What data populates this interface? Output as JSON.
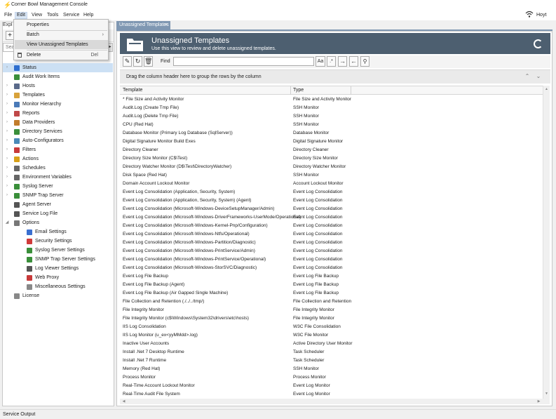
{
  "window": {
    "title": "Corner Bowl Management Console",
    "user": "Hoyt"
  },
  "menu": {
    "file": "File",
    "edit": "Edit",
    "view": "View",
    "tools": "Tools",
    "service": "Service",
    "help": "Help"
  },
  "edit_menu": {
    "properties": "Properties",
    "batch": "Batch",
    "view_unassigned": "View Unassigned Templates",
    "delete": "Delete",
    "delete_shortcut": "Del"
  },
  "explorer": {
    "tab_label": "Expl",
    "search_placeholder": "Sear"
  },
  "tree": [
    {
      "label": "Status",
      "icon": "info-icon",
      "color": "#2f6fcf"
    },
    {
      "label": "Audit Work Items",
      "icon": "checklist-icon",
      "color": "#3a8f3a"
    },
    {
      "label": "Hosts",
      "icon": "host-icon",
      "color": "#5a6a8a"
    },
    {
      "label": "Templates",
      "icon": "templates-icon",
      "color": "#d8a23a"
    },
    {
      "label": "Monitor Hierarchy",
      "icon": "hierarchy-icon",
      "color": "#4a7ab8"
    },
    {
      "label": "Reports",
      "icon": "report-icon",
      "color": "#c04848"
    },
    {
      "label": "Data Providers",
      "icon": "data-icon",
      "color": "#c27c2c"
    },
    {
      "label": "Directory Services",
      "icon": "tree-icon",
      "color": "#3b8f3b"
    },
    {
      "label": "Auto-Configurators",
      "icon": "gear-icon",
      "color": "#4a8ab8"
    },
    {
      "label": "Filters",
      "icon": "filter-icon",
      "color": "#c83a3a"
    },
    {
      "label": "Actions",
      "icon": "lightning-icon",
      "color": "#d8a018"
    },
    {
      "label": "Schedules",
      "icon": "clock-icon",
      "color": "#666666"
    },
    {
      "label": "Environment Variables",
      "icon": "variables-icon",
      "color": "#666666"
    },
    {
      "label": "Syslog Server",
      "icon": "syslog-icon",
      "color": "#3a8f3a"
    },
    {
      "label": "SNMP Trap Server",
      "icon": "snmp-icon",
      "color": "#3a8f3a"
    },
    {
      "label": "Agent Server",
      "icon": "agent-icon",
      "color": "#555555"
    },
    {
      "label": "Service Log File",
      "icon": "log-icon",
      "color": "#555555"
    },
    {
      "label": "Options",
      "icon": "gear-icon",
      "color": "#777777"
    },
    {
      "label": "Email Settings",
      "icon": "email-icon",
      "color": "#3a6fd0"
    },
    {
      "label": "Security Settings",
      "icon": "security-icon",
      "color": "#d03a3a"
    },
    {
      "label": "Syslog Server Settings",
      "icon": "syslog-icon",
      "color": "#3a8f3a"
    },
    {
      "label": "SNMP Trap Server Settings",
      "icon": "snmp-icon",
      "color": "#3a8f3a"
    },
    {
      "label": "Log Viewer Settings",
      "icon": "log-viewer-icon",
      "color": "#555555"
    },
    {
      "label": "Web Proxy",
      "icon": "globe-icon",
      "color": "#c83a3a"
    },
    {
      "label": "Miscellaneous Settings",
      "icon": "gear-icon",
      "color": "#888888"
    },
    {
      "label": "License",
      "icon": "key-icon",
      "color": "#888888"
    }
  ],
  "doc": {
    "tab_label": "Unassigned Templates",
    "banner_title": "Unassigned Templates",
    "banner_subtitle": "Use this view to review and delete unassigned templates.",
    "find_label": "Find",
    "group_hint": "Drag the column header here to group the rows by the column",
    "columns": [
      "Template",
      "Type"
    ],
    "rows": [
      [
        "* File Size and Activity Monitor",
        "File Size and Activity Monitor"
      ],
      [
        "Audit.Log (Create Tmp File)",
        "SSH Monitor"
      ],
      [
        "Audit.Log (Delete Tmp File)",
        "SSH Monitor"
      ],
      [
        "CPU (Red Hat)",
        "SSH Monitor"
      ],
      [
        "Database Monitor (Primary Log Database (SqlServer))",
        "Database Monitor"
      ],
      [
        "Digital Signature Monitor Build Exes",
        "Digital Signature Monitor"
      ],
      [
        "Directory Cleaner",
        "Directory Cleaner"
      ],
      [
        "Directory Size Monitor (C$\\Test)",
        "Directory Size Monitor"
      ],
      [
        "Directory Watcher Monitor (D$\\Test\\DirectoryWatcher)",
        "Directory Watcher Monitor"
      ],
      [
        "Disk Space (Red Hat)",
        "SSH Monitor"
      ],
      [
        "Domain Account Lockout Monitor",
        "Account Lockout Monitor"
      ],
      [
        "Event Log Consolidation (Application, Security, System)",
        "Event Log Consolidation"
      ],
      [
        "Event Log Consolidation (Application, Security, System) (Agent)",
        "Event Log Consolidation"
      ],
      [
        "Event Log Consolidation (Microsoft-Windows-DeviceSetupManager/Admin)",
        "Event Log Consolidation"
      ],
      [
        "Event Log Consolidation (Microsoft-Windows-DriverFrameworks-UserMode/Operational)",
        "Event Log Consolidation"
      ],
      [
        "Event Log Consolidation (Microsoft-Windows-Kernel-Pnp/Configuration)",
        "Event Log Consolidation"
      ],
      [
        "Event Log Consolidation (Microsoft-Windows-Ntfs/Operational)",
        "Event Log Consolidation"
      ],
      [
        "Event Log Consolidation (Microsoft-Windows-Partition/Diagnostic)",
        "Event Log Consolidation"
      ],
      [
        "Event Log Consolidation (Microsoft-Windows-PrintService/Admin)",
        "Event Log Consolidation"
      ],
      [
        "Event Log Consolidation (Microsoft-Windows-PrintService/Operational)",
        "Event Log Consolidation"
      ],
      [
        "Event Log Consolidation (Microsoft-Windows-StorSVC/Diagnostic)",
        "Event Log Consolidation"
      ],
      [
        "Event Log File Backup",
        "Event Log File Backup"
      ],
      [
        "Event Log File Backup (Agent)",
        "Event Log File Backup"
      ],
      [
        "Event Log File Backup (Air Gapped Single Machine)",
        "Event Log File Backup"
      ],
      [
        "File Collection and Retention (./../../tmp/)",
        "File Collection and Retention"
      ],
      [
        "File Integrity Monitor",
        "File Integrity Monitor"
      ],
      [
        "File Integrity Monitor (c$\\Windows\\System32\\drivers\\etc\\hosts)",
        "File Integrity Monitor"
      ],
      [
        "IIS Log Consolidation",
        "W3C File Consolidation"
      ],
      [
        "IIS Log Monitor (u_ex<yyMMdd>.log)",
        "W3C File Monitor"
      ],
      [
        "Inactive User Accounts",
        "Active Directory User Monitor"
      ],
      [
        "Install .Net 7 Desktop Runtime",
        "Task Scheduler"
      ],
      [
        "Install .Net 7 Runtime",
        "Task Scheduler"
      ],
      [
        "Memory (Red Hat)",
        "SSH Monitor"
      ],
      [
        "Process Monitor",
        "Process Monitor"
      ],
      [
        "Real-Time Account Lockout Monitor",
        "Event Log Monitor"
      ],
      [
        "Real-Time Audit File System",
        "Event Log Monitor"
      ]
    ]
  },
  "status": {
    "text": "Service Output"
  }
}
